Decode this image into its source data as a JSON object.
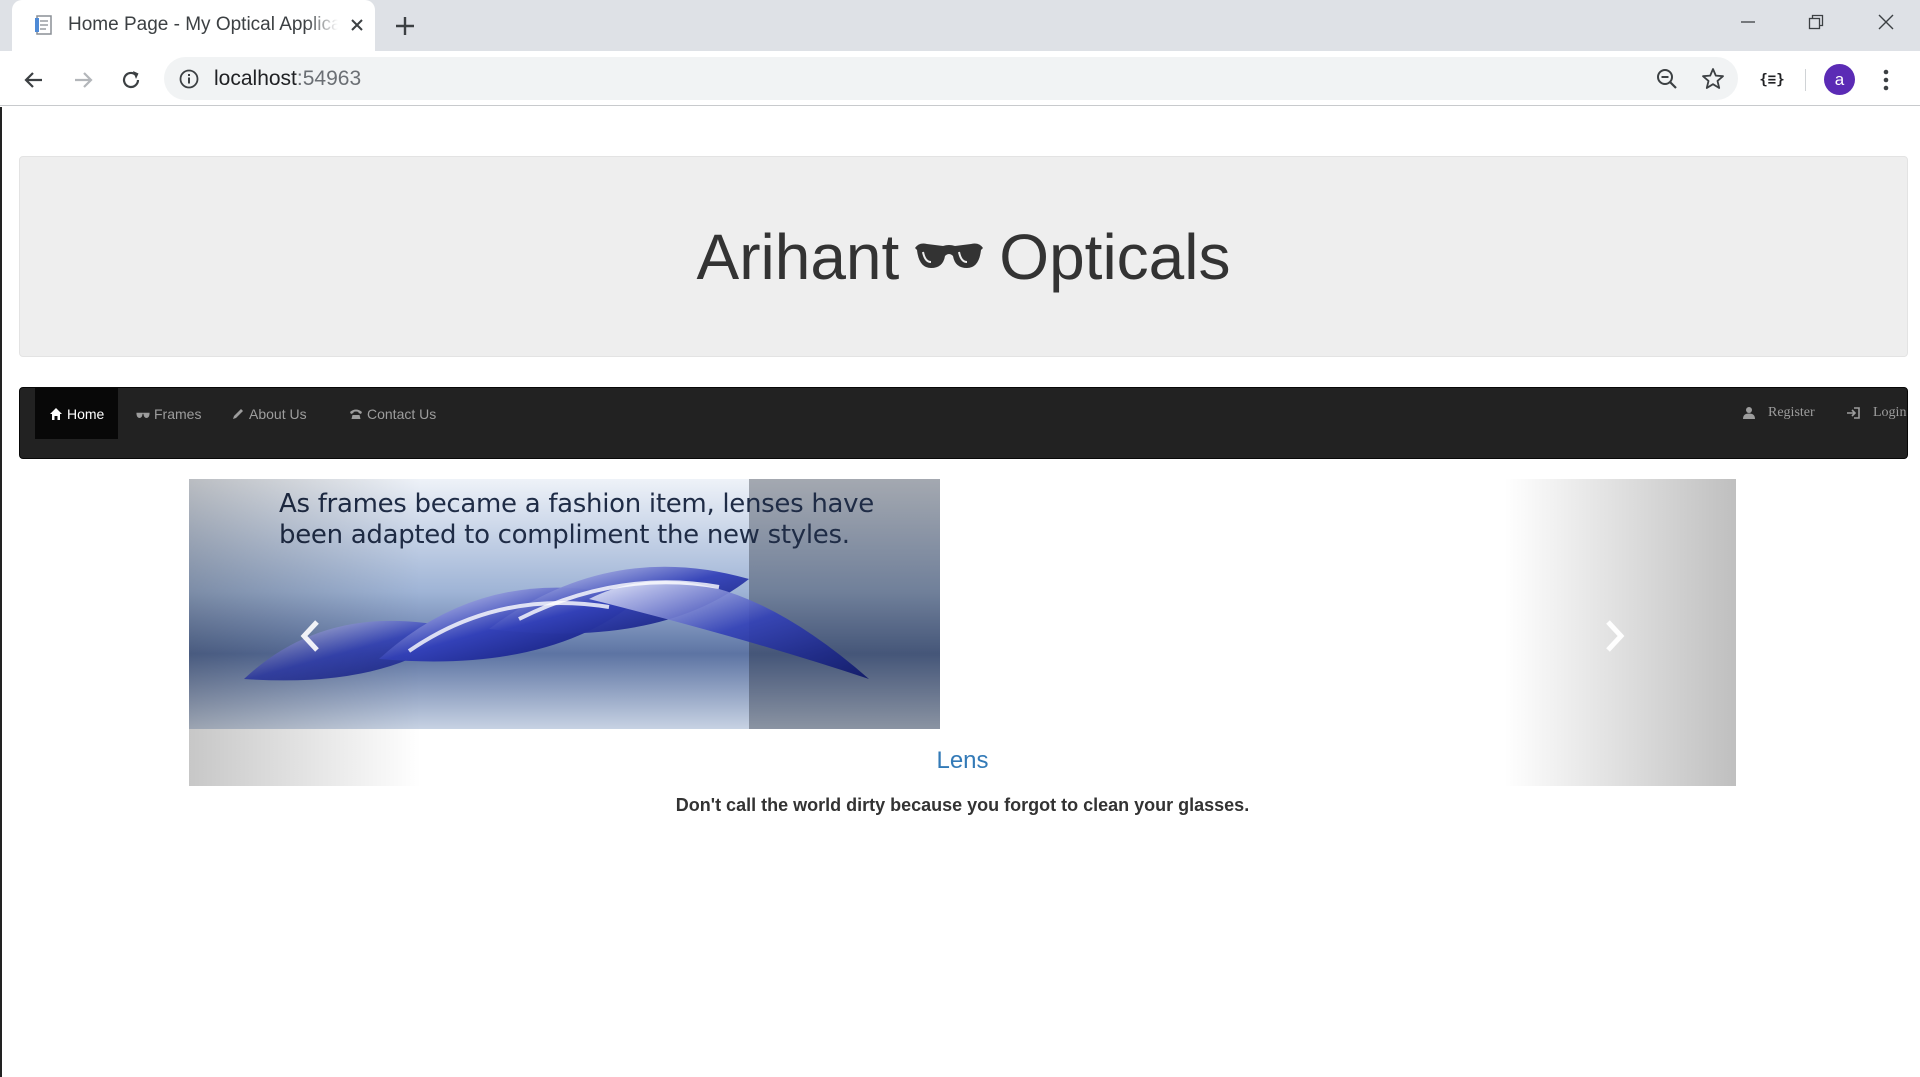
{
  "browser": {
    "tab_title": "Home Page - My Optical Application",
    "url_host": "localhost",
    "url_port": ":54963",
    "extension_label": "{≡}",
    "profile_initial": "a"
  },
  "site": {
    "brand_left": "Arihant",
    "brand_right": "Opticals",
    "brand_icon": "sunglasses-icon"
  },
  "navbar": {
    "items": [
      {
        "label": "Home",
        "icon": "home-icon",
        "active": true
      },
      {
        "label": "Frames",
        "icon": "glasses-icon",
        "active": false
      },
      {
        "label": "About Us",
        "icon": "pencil-icon",
        "active": false
      },
      {
        "label": "Contact Us",
        "icon": "phone-icon",
        "active": false
      }
    ],
    "right_items": [
      {
        "label": "Register",
        "icon": "user-icon"
      },
      {
        "label": "Login",
        "icon": "login-icon"
      }
    ]
  },
  "carousel": {
    "image_text": "As frames became a fashion item, lenses have been adapted to compliment the new styles.",
    "caption_title": "Lens",
    "caption_text": "Don't call the world dirty because you forgot to clean your glasses."
  },
  "colors": {
    "navbar_bg": "#222222",
    "jumbotron_bg": "#eeeeee",
    "link": "#337ab7",
    "avatar": "#5b2bb5"
  }
}
